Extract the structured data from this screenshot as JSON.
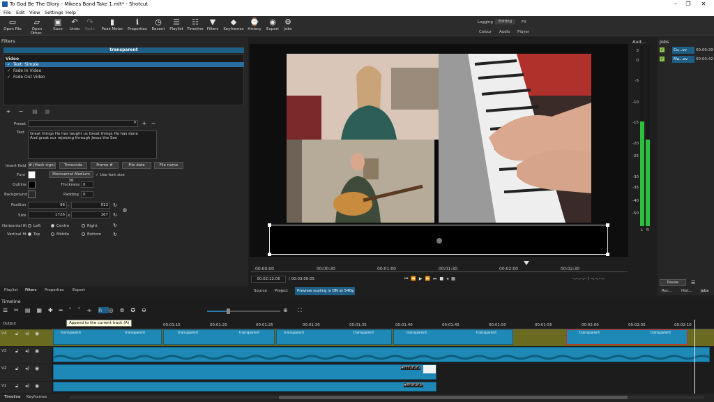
{
  "window": {
    "title": "To God Be The Glory - Mikees Band Take 1.mlt* - Shotcut",
    "minimize": "–",
    "maximize": "❐",
    "close": "✕"
  },
  "menu": [
    "File",
    "Edit",
    "View",
    "Settings",
    "Help"
  ],
  "toolbar": [
    {
      "label": "Open File",
      "icon": "folder-open-icon"
    },
    {
      "label": "Open Other..",
      "icon": "open-other-icon"
    },
    {
      "label": "Save",
      "icon": "save-icon"
    },
    {
      "label": "Undo",
      "icon": "undo-icon"
    },
    {
      "label": "Redo",
      "icon": "redo-icon"
    },
    {
      "label": "Peak Meter",
      "icon": "peak-meter-icon"
    },
    {
      "label": "Properties",
      "icon": "properties-icon"
    },
    {
      "label": "Recent",
      "icon": "recent-icon"
    },
    {
      "label": "Playlist",
      "icon": "playlist-icon"
    },
    {
      "label": "Timeline",
      "icon": "timeline-icon"
    },
    {
      "label": "Filters",
      "icon": "filter-icon"
    },
    {
      "label": "Keyframes",
      "icon": "keyframes-icon"
    },
    {
      "label": "History",
      "icon": "history-icon"
    },
    {
      "label": "Export",
      "icon": "export-icon"
    },
    {
      "label": "Jobs",
      "icon": "jobs-icon"
    }
  ],
  "layouts": {
    "logging": "Logging",
    "editing": "Editing",
    "fx": "FX",
    "colour": "Colour",
    "audio": "Audio",
    "player": "Player"
  },
  "filters": {
    "header": "Filters",
    "clip_name": "transparent",
    "section": "Video",
    "items": [
      "Text: Simple",
      "Fade In Video",
      "Fade Out Video"
    ],
    "preset_label": "Preset",
    "text_label": "Text",
    "text_value_line1": "Great things He has taught us  Great things He has done",
    "text_value_line2": "And great our rejoicing through Jesus the Son",
    "insert_field_label": "Insert field",
    "insert_buttons": [
      "# (Hash sign)",
      "Timecode",
      "Frame #",
      "File date",
      "File name"
    ],
    "font_label": "Font",
    "font_name": "Montserrat Medium 36",
    "use_font_size": "Use font size",
    "outline_label": "Outline",
    "thickness_label": "Thickness",
    "thickness_value": "0",
    "background_label": "Background",
    "padding_label": "Padding",
    "padding_value": "0",
    "position_label": "Position",
    "position_x": "96",
    "position_y": "913",
    "size_label": "Size",
    "size_w": "1726",
    "size_h": "167",
    "size_sep": "x",
    "pos_sep": ",",
    "hfit_label": "Horizontal fit",
    "hfit_options": [
      "Left",
      "Centre",
      "Right"
    ],
    "vfit_label": "Vertical fit",
    "vfit_options": [
      "Top",
      "Middle",
      "Bottom"
    ]
  },
  "left_tabs": [
    "Playlist",
    "Filters",
    "Properties",
    "Export"
  ],
  "player": {
    "ruler": [
      "00:00:00",
      "00:00:30",
      "00:01:00",
      "00:01:30",
      "00:02:00",
      "00:02:30"
    ],
    "current_time": "00:02:12:06",
    "total_time": "/ 00:03:00:05",
    "in_out": "--:--:--:-- /  --:--:--:--",
    "tabs": [
      "Source",
      "Project"
    ],
    "scaling_notice": "Preview scaling is ON at 540p"
  },
  "audio": {
    "header": "Aud...",
    "ticks": [
      "3",
      "0",
      "-5",
      "-10",
      "-15",
      "-20",
      "-25",
      "-30",
      "-35",
      "-40",
      "-50"
    ],
    "channels": [
      "L",
      "R"
    ],
    "level_l": 0.58,
    "level_r": 0.48
  },
  "jobs": {
    "header": "Jobs",
    "items": [
      {
        "name": "Co...ov",
        "time": "00:00:39"
      },
      {
        "name": "Ma...ov",
        "time": "00:00:42"
      }
    ],
    "pause_label": "Pause",
    "tabs": [
      "Rec...",
      "Hist...",
      "Jobs"
    ]
  },
  "timeline": {
    "header": "Timeline",
    "tooltip": "Append to the current track (A)",
    "output_label": "Output",
    "ruler": [
      "00:01:15",
      "00:01:20",
      "00:01:25",
      "00:01:30",
      "00:01:35",
      "00:01:40",
      "00:01:45",
      "00:01:50",
      "00:01:55",
      "00:02:00",
      "00:02:05",
      "00:02:10"
    ],
    "tracks": [
      "V4",
      "V3",
      "V2",
      "V1"
    ],
    "clip_label": "transparent",
    "v2_clip": "#FFF2F2F2",
    "v1_clip": "#FF3F3F3F",
    "bottom_tabs": [
      "Timeline",
      "Keyframes"
    ]
  }
}
